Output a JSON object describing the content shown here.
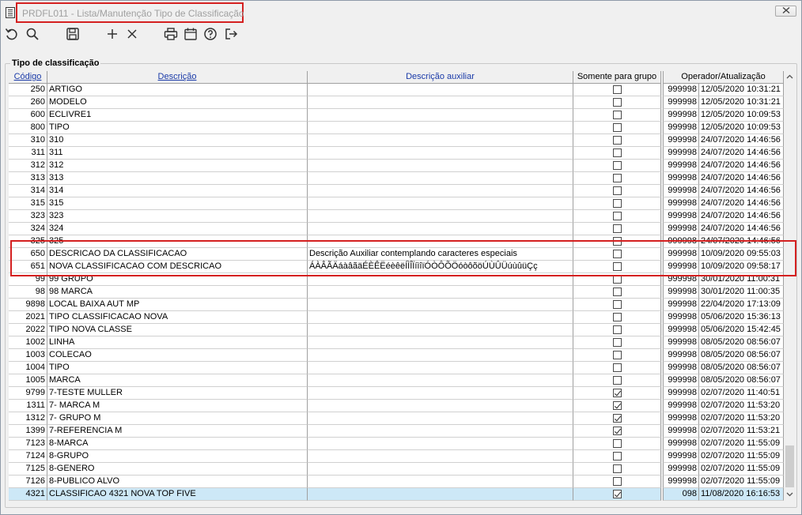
{
  "window": {
    "title": "PRDFL011 - Lista/Manutenção Tipo de Classificação",
    "close_icon": "close-x-icon"
  },
  "toolbar": {
    "icons": [
      "undo-icon",
      "search-icon",
      "save-icon",
      "add-icon",
      "delete-icon",
      "print-icon",
      "calendar-icon",
      "help-icon",
      "exit-icon"
    ]
  },
  "group": {
    "label": "Tipo de classificação"
  },
  "columns": {
    "code": "Código",
    "desc": "Descrição",
    "aux": "Descrição auxiliar",
    "group_only": "Somente para grupo",
    "operator": "Operador/Atualização"
  },
  "rows": [
    {
      "code": "250",
      "desc": "ARTIGO",
      "aux": "",
      "group": false,
      "op": "999998",
      "dt": "12/05/2020 10:31:21"
    },
    {
      "code": "260",
      "desc": "MODELO",
      "aux": "",
      "group": false,
      "op": "999998",
      "dt": "12/05/2020 10:31:21"
    },
    {
      "code": "600",
      "desc": "ECLIVRE1",
      "aux": "",
      "group": false,
      "op": "999998",
      "dt": "12/05/2020 10:09:53"
    },
    {
      "code": "800",
      "desc": "TIPO",
      "aux": "",
      "group": false,
      "op": "999998",
      "dt": "12/05/2020 10:09:53"
    },
    {
      "code": "310",
      "desc": "310",
      "aux": "",
      "group": false,
      "op": "999998",
      "dt": "24/07/2020 14:46:56"
    },
    {
      "code": "311",
      "desc": "311",
      "aux": "",
      "group": false,
      "op": "999998",
      "dt": "24/07/2020 14:46:56"
    },
    {
      "code": "312",
      "desc": "312",
      "aux": "",
      "group": false,
      "op": "999998",
      "dt": "24/07/2020 14:46:56"
    },
    {
      "code": "313",
      "desc": "313",
      "aux": "",
      "group": false,
      "op": "999998",
      "dt": "24/07/2020 14:46:56"
    },
    {
      "code": "314",
      "desc": "314",
      "aux": "",
      "group": false,
      "op": "999998",
      "dt": "24/07/2020 14:46:56"
    },
    {
      "code": "315",
      "desc": "315",
      "aux": "",
      "group": false,
      "op": "999998",
      "dt": "24/07/2020 14:46:56"
    },
    {
      "code": "323",
      "desc": "323",
      "aux": "",
      "group": false,
      "op": "999998",
      "dt": "24/07/2020 14:46:56"
    },
    {
      "code": "324",
      "desc": "324",
      "aux": "",
      "group": false,
      "op": "999998",
      "dt": "24/07/2020 14:46:56"
    },
    {
      "code": "325",
      "desc": "325",
      "aux": "",
      "group": false,
      "op": "999998",
      "dt": "24/07/2020 14:46:56"
    },
    {
      "code": "650",
      "desc": "DESCRICAO DA CLASSIFICACAO",
      "aux": "Descrição Auxiliar contemplando caracteres especiais",
      "group": false,
      "op": "999998",
      "dt": "10/09/2020 09:55:03"
    },
    {
      "code": "651",
      "desc": "NOVA CLASSIFICACAO COM DESCRICAO",
      "aux": "ÁÀÂÃÄáàâãäÉÈÊËéèêëÍÌÎÏíìîïÓÒÔÕÖóòôõöÚÙÛÜúùûüÇç",
      "group": false,
      "op": "999998",
      "dt": "10/09/2020 09:58:17"
    },
    {
      "code": "99",
      "desc": "99 GRUPO",
      "aux": "",
      "group": false,
      "op": "999998",
      "dt": "30/01/2020 11:00:31"
    },
    {
      "code": "98",
      "desc": "98 MARCA",
      "aux": "",
      "group": false,
      "op": "999998",
      "dt": "30/01/2020 11:00:35"
    },
    {
      "code": "9898",
      "desc": "LOCAL BAIXA AUT MP",
      "aux": "",
      "group": false,
      "op": "999998",
      "dt": "22/04/2020 17:13:09"
    },
    {
      "code": "2021",
      "desc": "TIPO CLASSIFICACAO NOVA",
      "aux": "",
      "group": false,
      "op": "999998",
      "dt": "05/06/2020 15:36:13"
    },
    {
      "code": "2022",
      "desc": "TIPO NOVA CLASSE",
      "aux": "",
      "group": false,
      "op": "999998",
      "dt": "05/06/2020 15:42:45"
    },
    {
      "code": "1002",
      "desc": "LINHA",
      "aux": "",
      "group": false,
      "op": "999998",
      "dt": "08/05/2020 08:56:07"
    },
    {
      "code": "1003",
      "desc": "COLECAO",
      "aux": "",
      "group": false,
      "op": "999998",
      "dt": "08/05/2020 08:56:07"
    },
    {
      "code": "1004",
      "desc": "TIPO",
      "aux": "",
      "group": false,
      "op": "999998",
      "dt": "08/05/2020 08:56:07"
    },
    {
      "code": "1005",
      "desc": "MARCA",
      "aux": "",
      "group": false,
      "op": "999998",
      "dt": "08/05/2020 08:56:07"
    },
    {
      "code": "9799",
      "desc": "7-TESTE MULLER",
      "aux": "",
      "group": true,
      "op": "999998",
      "dt": "02/07/2020 11:40:51"
    },
    {
      "code": "1311",
      "desc": "7- MARCA M",
      "aux": "",
      "group": true,
      "op": "999998",
      "dt": "02/07/2020 11:53:20"
    },
    {
      "code": "1312",
      "desc": "7- GRUPO M",
      "aux": "",
      "group": true,
      "op": "999998",
      "dt": "02/07/2020 11:53:20"
    },
    {
      "code": "1399",
      "desc": "7-REFERENCIA M",
      "aux": "",
      "group": true,
      "op": "999998",
      "dt": "02/07/2020 11:53:21"
    },
    {
      "code": "7123",
      "desc": "8-MARCA",
      "aux": "",
      "group": false,
      "op": "999998",
      "dt": "02/07/2020 11:55:09"
    },
    {
      "code": "7124",
      "desc": "8-GRUPO",
      "aux": "",
      "group": false,
      "op": "999998",
      "dt": "02/07/2020 11:55:09"
    },
    {
      "code": "7125",
      "desc": "8-GENERO",
      "aux": "",
      "group": false,
      "op": "999998",
      "dt": "02/07/2020 11:55:09"
    },
    {
      "code": "7126",
      "desc": "8-PUBLICO ALVO",
      "aux": "",
      "group": false,
      "op": "999998",
      "dt": "02/07/2020 11:55:09"
    },
    {
      "code": "4321",
      "desc": "CLASSIFICAO 4321 NOVA TOP FIVE",
      "aux": "",
      "group": true,
      "op": "098",
      "dt": "11/08/2020 16:16:53",
      "selected": true
    }
  ],
  "colors": {
    "highlight_border": "#d42020",
    "selection": "#cde8f7",
    "header_link": "#1a3aa8"
  }
}
